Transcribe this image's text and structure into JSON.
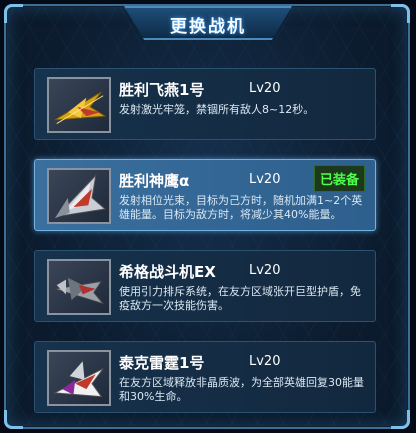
{
  "panel": {
    "title": "更换战机"
  },
  "fighters": [
    {
      "name": "胜利飞燕1号",
      "level": "Lv20",
      "desc": "发射激光牢笼，禁锢所有敌人8~12秒。",
      "icon": "gold-fighter-icon"
    },
    {
      "name": "胜利神鹰α",
      "level": "Lv20",
      "desc": "发射相位光束，目标为己方时，随机加满1~2个英雄能量。目标为敌方时，将减少其40%能量。",
      "status": "已装备",
      "icon": "silver-red-fighter-icon"
    },
    {
      "name": "希格战斗机EX",
      "level": "Lv20",
      "desc": "使用引力排斥系统，在友方区域张开巨型护盾，免疫敌方一次技能伤害。",
      "icon": "grey-fighter-icon"
    },
    {
      "name": "泰克雷霆1号",
      "level": "Lv20",
      "desc": "在友方区域释放非晶质波，为全部英雄回复30能量和30%生命。",
      "icon": "white-red-fighter-icon"
    }
  ],
  "colors": {
    "equipped": "#4dff4d",
    "accent": "#4a8bbb"
  }
}
